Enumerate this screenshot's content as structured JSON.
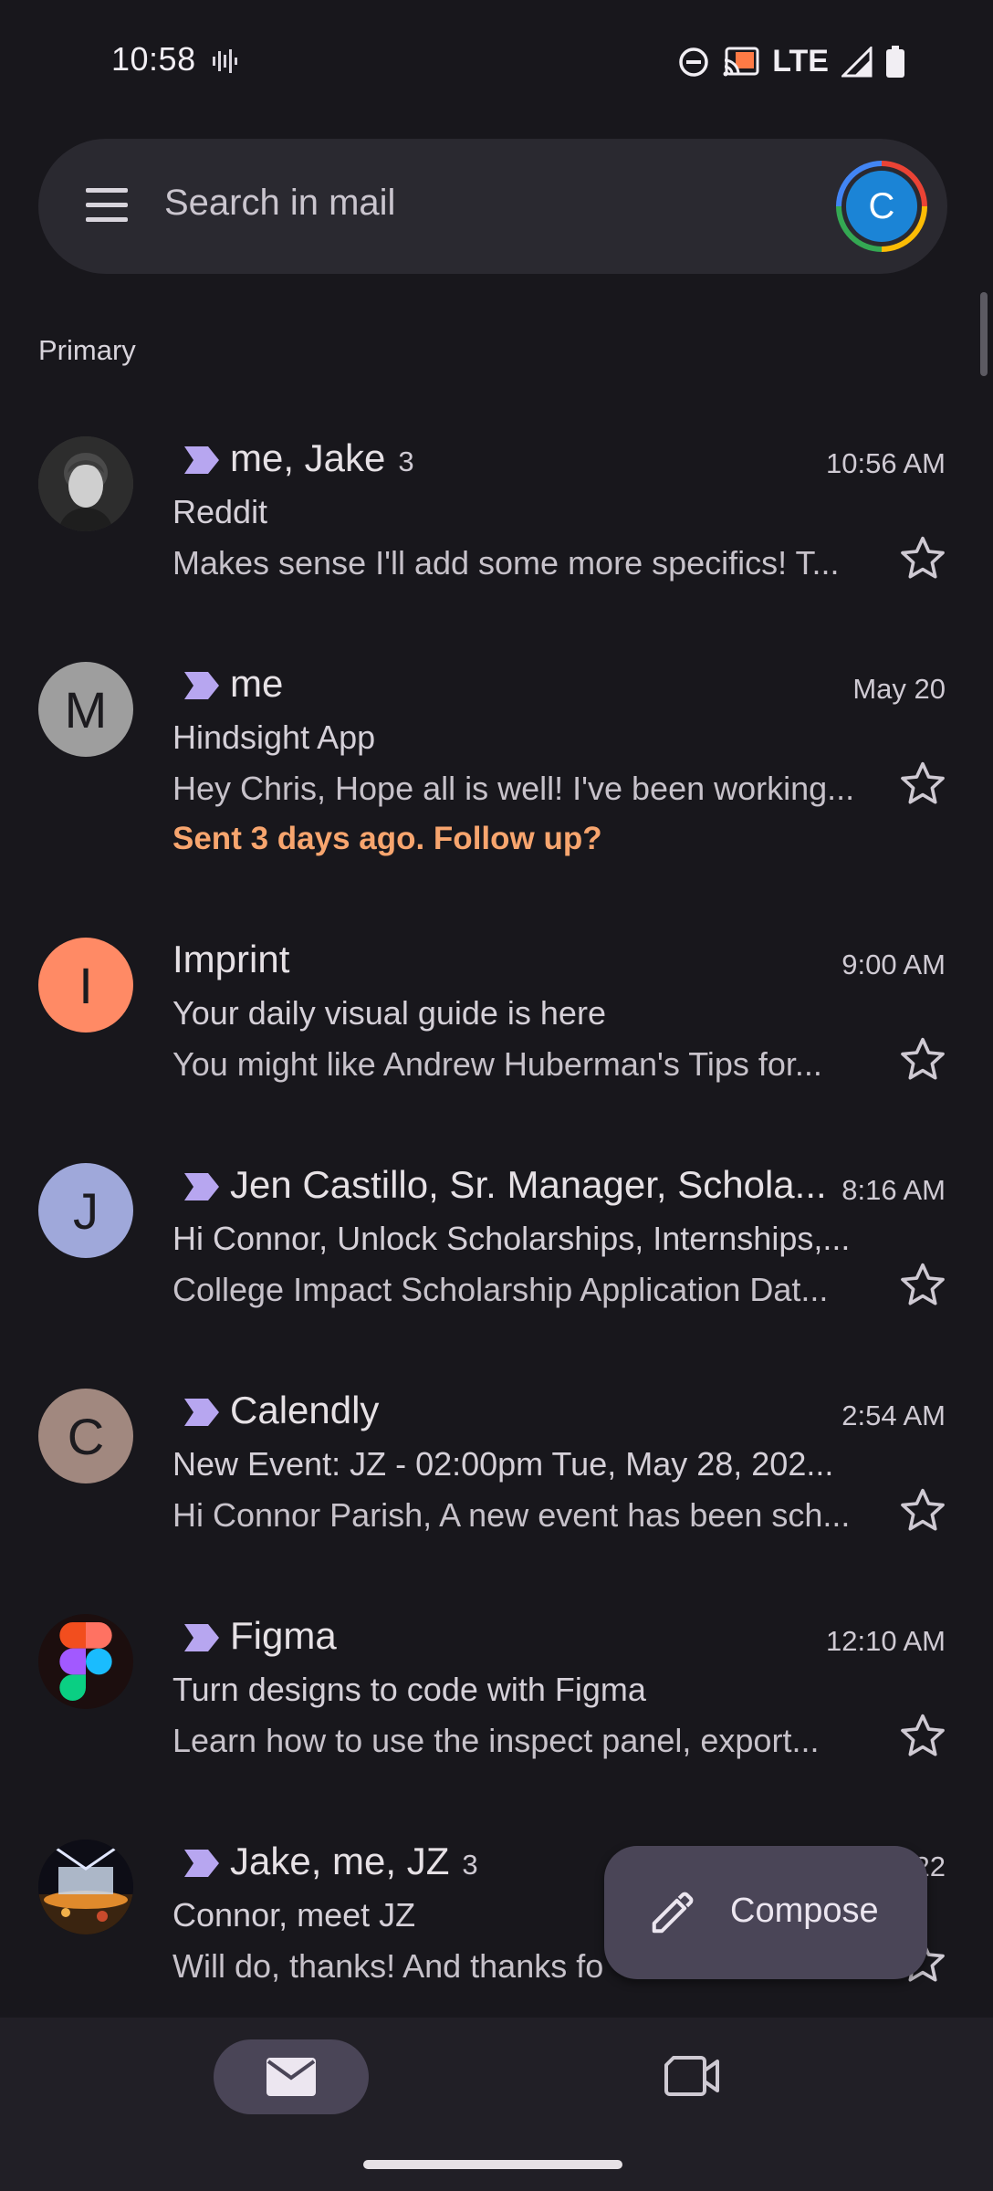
{
  "status_bar": {
    "time": "10:58",
    "network": "LTE"
  },
  "search": {
    "placeholder": "Search in mail",
    "account_initial": "C"
  },
  "section": "Primary",
  "emails": [
    {
      "sender": "me, Jake",
      "count": "3",
      "date": "10:56 AM",
      "subject": "Reddit",
      "snippet": "Makes sense I'll add some more specifics! T...",
      "important": true,
      "avatar": {
        "type": "photo",
        "name": "person-photo"
      }
    },
    {
      "sender": "me",
      "count": "",
      "date": "May 20",
      "subject": "Hindsight App",
      "snippet": "Hey Chris, Hope all is well! I've been working...",
      "followup": "Sent 3 days ago. Follow up?",
      "important": true,
      "avatar": {
        "type": "letter",
        "letter": "M",
        "bg": "#9e9e9e",
        "fg": "#1c1b1f"
      }
    },
    {
      "sender": "Imprint",
      "count": "",
      "date": "9:00 AM",
      "subject": "Your daily visual guide is here",
      "snippet": "You might like Andrew Huberman's Tips for...",
      "important": false,
      "avatar": {
        "type": "letter",
        "letter": "I",
        "bg": "#ff8a65",
        "fg": "#1c1b1f"
      }
    },
    {
      "sender": "Jen Castillo, Sr. Manager, Schola...",
      "count": "",
      "date": "8:16 AM",
      "subject": "Hi Connor, Unlock Scholarships, Internships,...",
      "snippet": "College Impact Scholarship Application Dat...",
      "important": true,
      "avatar": {
        "type": "letter",
        "letter": "J",
        "bg": "#9fa8da",
        "fg": "#1c1b1f"
      }
    },
    {
      "sender": "Calendly",
      "count": "",
      "date": "2:54 AM",
      "subject": "New Event: JZ - 02:00pm Tue, May 28, 202...",
      "snippet": "Hi Connor Parish, A new event has been sch...",
      "important": true,
      "avatar": {
        "type": "letter",
        "letter": "C",
        "bg": "#a1887f",
        "fg": "#1c1b1f"
      }
    },
    {
      "sender": "Figma",
      "count": "",
      "date": "12:10 AM",
      "subject": "Turn designs to code with Figma",
      "snippet": "Learn how to use the inspect panel, export...",
      "important": true,
      "avatar": {
        "type": "figma",
        "name": "figma-logo"
      }
    },
    {
      "sender": "Jake, me, JZ",
      "count": "3",
      "date": "22",
      "subject": "Connor, meet JZ",
      "snippet": "Will do, thanks! And thanks fo",
      "important": true,
      "avatar": {
        "type": "photo2",
        "name": "concert-photo"
      }
    }
  ],
  "compose": {
    "label": "Compose"
  },
  "colors": {
    "background": "#18171c",
    "important": "#b7a6f0",
    "followup": "#f7a56e",
    "fab": "#4a4557"
  }
}
